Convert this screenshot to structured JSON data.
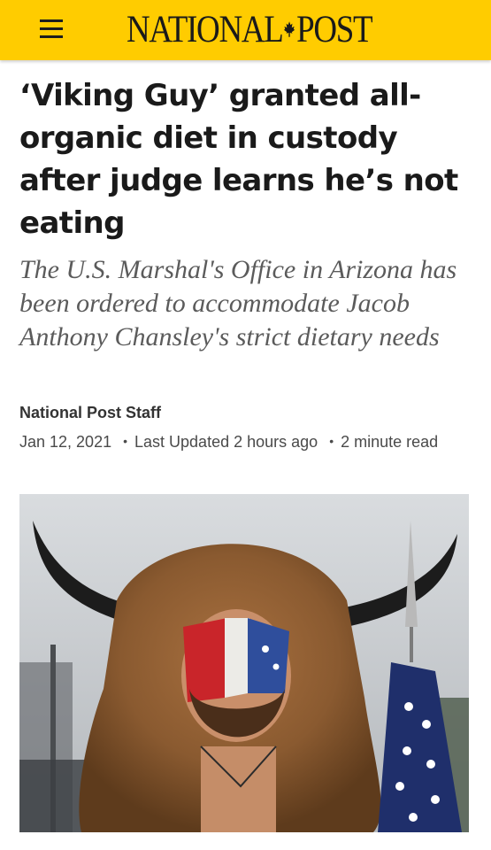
{
  "header": {
    "menu_icon": "hamburger-menu-icon",
    "logo_left": "NATIONAL",
    "logo_right": "POST",
    "logo_icon": "maple-leaf-icon",
    "brand_color": "#ffcc00"
  },
  "article": {
    "headline": "‘Viking Guy’ granted all-organic diet in custody after judge learns he’s not eating",
    "deck": "The U.S. Marshal's Office in Arizona has been ordered to accommodate Jacob Anthony Chansley's strict dietary needs",
    "author": "National Post Staff",
    "date": "Jan 12, 2021",
    "updated": "Last Updated 2 hours ago",
    "read_time": "2 minute read",
    "separator": "•"
  },
  "image": {
    "subject": "photo of man in horned fur headdress with red white and blue face paint, holding a flag on a spear"
  }
}
